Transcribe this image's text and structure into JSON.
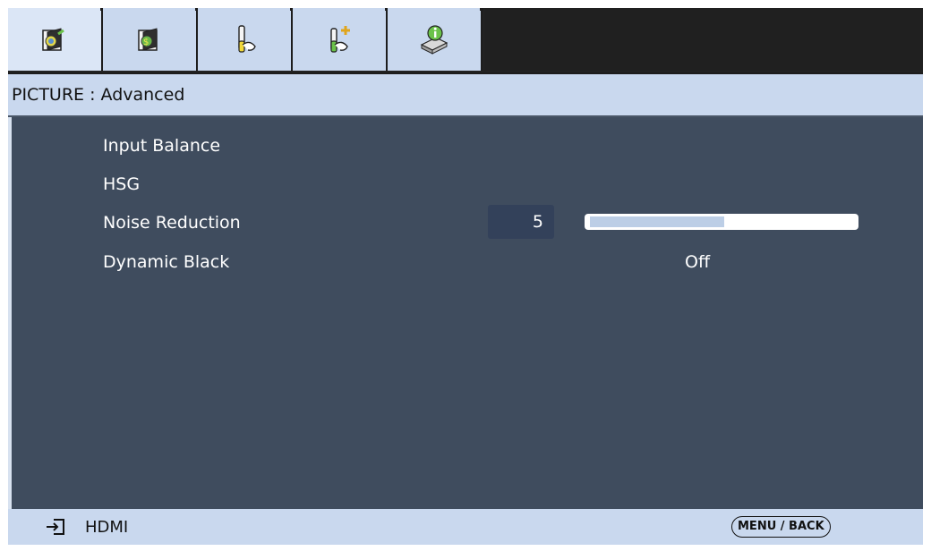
{
  "tabs": [
    {
      "name": "picture-tab",
      "icon": "picture-icon",
      "active": true
    },
    {
      "name": "picture-advanced-tab",
      "icon": "picture-settings-icon",
      "active": false
    },
    {
      "name": "setup-tab",
      "icon": "tools-icon",
      "active": false
    },
    {
      "name": "advanced-setup-tab",
      "icon": "tools-plus-icon",
      "active": false
    },
    {
      "name": "info-tab",
      "icon": "info-icon",
      "active": false
    }
  ],
  "header": {
    "title": "PICTURE : Advanced"
  },
  "menu": {
    "items": [
      {
        "label": "Input Balance"
      },
      {
        "label": "HSG"
      },
      {
        "label": "Noise Reduction",
        "value": "5",
        "level_percent": 51
      },
      {
        "label": "Dynamic Black",
        "value": "Off"
      }
    ]
  },
  "status": {
    "source": "HDMI",
    "source_icon": "input-source-icon",
    "back_button": "MENU / BACK"
  },
  "colors": {
    "panel": "#3f4c5e",
    "header": "#c9d8ee",
    "tabbar": "#222222"
  }
}
